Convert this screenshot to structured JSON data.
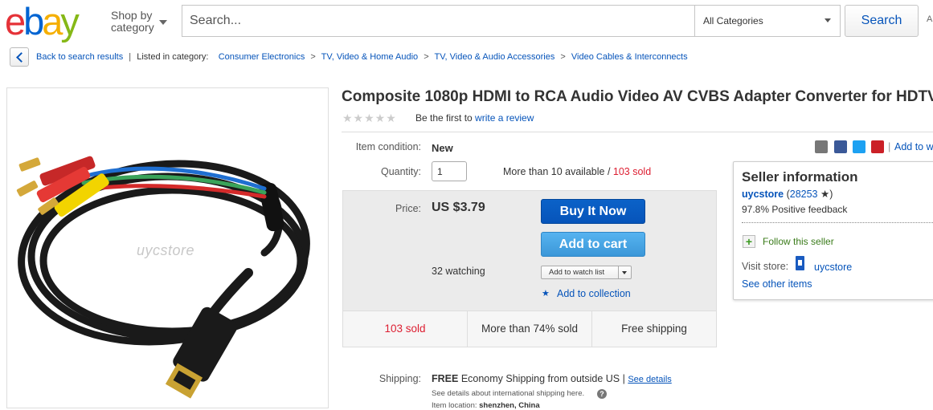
{
  "header": {
    "logo": {
      "e": "e",
      "b": "b",
      "a": "a",
      "y": "y"
    },
    "shop_by_category": [
      "Shop by",
      "category"
    ],
    "search_placeholder": "Search...",
    "category_select": "All Categories",
    "search_button": "Search",
    "advanced": "A"
  },
  "breadcrumb": {
    "back": "Back to search results",
    "listed_in": "Listed in category:",
    "categories": [
      "Consumer Electronics",
      "TV, Video & Home Audio",
      "TV, Video & Audio Accessories",
      "Video Cables & Interconnects"
    ],
    "separator": ">"
  },
  "image": {
    "watermark": "uycstore"
  },
  "listing": {
    "title": "Composite 1080p HDMI to RCA Audio Video AV CVBS Adapter Converter for HDTV",
    "rating_stars": "★★★★★",
    "rating_prefix": "Be the first to ",
    "rating_link": "write a review",
    "condition_label": "Item condition:",
    "condition_value": "New",
    "quantity_label": "Quantity:",
    "quantity_value": "1",
    "available_text": "More than 10 available / ",
    "sold_text": "103 sold",
    "price_label": "Price:",
    "price_value": "US $3.79",
    "buy_now": "Buy It Now",
    "add_to_cart": "Add to cart",
    "watching": "32 watching",
    "add_to_watch": "Add to watch list",
    "add_to_collection": "Add to collection",
    "stats": [
      "103 sold",
      "More than 74% sold",
      "Free shipping"
    ]
  },
  "share": {
    "add_to": "Add to w",
    "pipe": "|"
  },
  "seller": {
    "title": "Seller information",
    "name": "uycstore",
    "score_open": " (",
    "score": "28253",
    "score_close": " ★)",
    "feedback": "97.8% Positive feedback",
    "follow": "Follow this seller",
    "visit_store": "Visit store:",
    "store_name": "uycstore",
    "see_other": "See other items"
  },
  "shipping": {
    "label": "Shipping:",
    "free": "FREE",
    "method": " Economy Shipping from outside US | ",
    "see_details": "See details",
    "note": "See details about international shipping here.",
    "location_label": "Item location: ",
    "location": "shenzhen, China"
  },
  "colors": {
    "link": "#0654ba",
    "buy_now": "#0654ba",
    "add_to_cart": "#3b97d8",
    "sold_red": "#dd1e31"
  }
}
